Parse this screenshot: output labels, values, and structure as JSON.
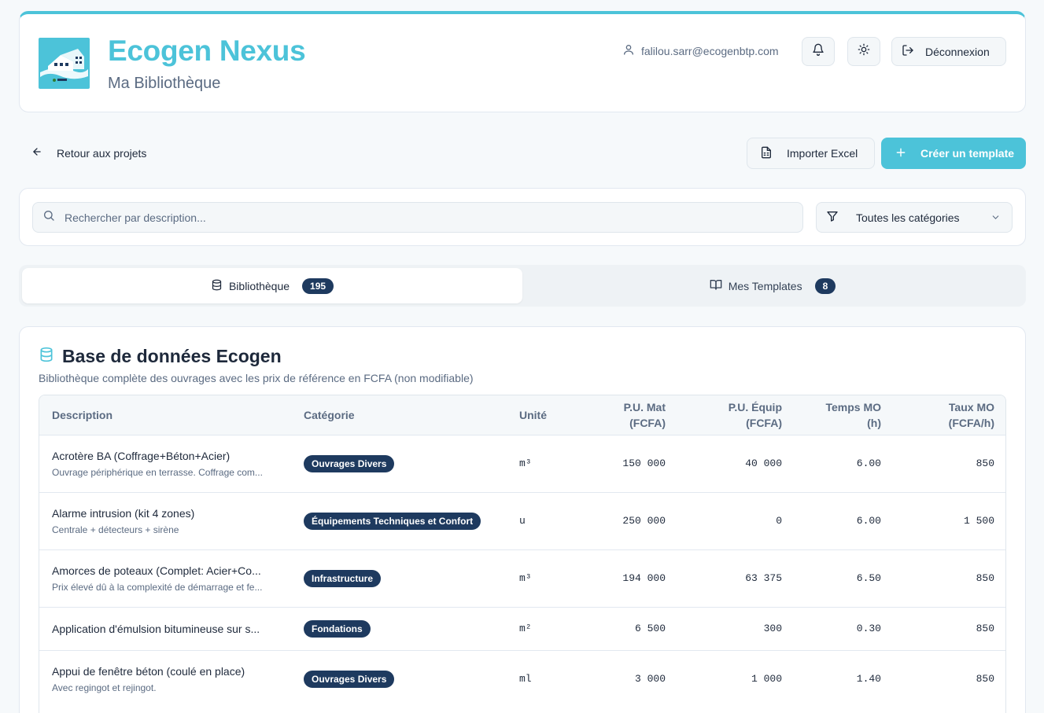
{
  "header": {
    "title": "Ecogen Nexus",
    "subtitle": "Ma Bibliothèque",
    "user_email": "falilou.sarr@ecogenbtp.com",
    "logout_label": "Déconnexion"
  },
  "toolbar": {
    "back_label": "Retour aux projets",
    "import_label": "Importer Excel",
    "create_label": "Créer un template"
  },
  "filters": {
    "search_placeholder": "Rechercher par description...",
    "category_selected": "Toutes les catégories"
  },
  "tabs": [
    {
      "label": "Bibliothèque",
      "count": "195",
      "active": true
    },
    {
      "label": "Mes Templates",
      "count": "8",
      "active": false
    }
  ],
  "library": {
    "title": "Base de données Ecogen",
    "description": "Bibliothèque complète des ouvrages avec les prix de référence en FCFA (non modifiable)",
    "columns": {
      "description": "Description",
      "category": "Catégorie",
      "unit": "Unité",
      "pu_mat_1": "P.U. Mat",
      "pu_mat_2": "(FCFA)",
      "pu_equip_1": "P.U. Équip",
      "pu_equip_2": "(FCFA)",
      "temps_1": "Temps MO",
      "temps_2": "(h)",
      "taux_1": "Taux MO",
      "taux_2": "(FCFA/h)"
    },
    "rows": [
      {
        "title": "Acrotère BA (Coffrage+Béton+Acier)",
        "subtitle": "Ouvrage périphérique en terrasse. Coffrage com...",
        "category": "Ouvrages Divers",
        "unit": "m³",
        "pu_mat": "150 000",
        "pu_equip": "40 000",
        "temps": "6.00",
        "taux": "850"
      },
      {
        "title": "Alarme intrusion (kit 4 zones)",
        "subtitle": "Centrale + détecteurs + sirène",
        "category": "Équipements Techniques et Confort",
        "unit": "u",
        "pu_mat": "250 000",
        "pu_equip": "0",
        "temps": "6.00",
        "taux": "1 500"
      },
      {
        "title": "Amorces de poteaux (Complet: Acier+Co...",
        "subtitle": "Prix élevé dû à la complexité de démarrage et fe...",
        "category": "Infrastructure",
        "unit": "m³",
        "pu_mat": "194 000",
        "pu_equip": "63 375",
        "temps": "6.50",
        "taux": "850"
      },
      {
        "title": "Application d'émulsion bitumineuse sur s...",
        "subtitle": "",
        "category": "Fondations",
        "unit": "m²",
        "pu_mat": "6 500",
        "pu_equip": "300",
        "temps": "0.30",
        "taux": "850"
      },
      {
        "title": "Appui de fenêtre béton (coulé en place)",
        "subtitle": "Avec regingot et rejingot.",
        "category": "Ouvrages Divers",
        "unit": "ml",
        "pu_mat": "3 000",
        "pu_equip": "1 000",
        "temps": "1.40",
        "taux": "850"
      }
    ]
  },
  "colors": {
    "accent": "#4cc3d9",
    "badge": "#1e3a5f",
    "muted_text": "#5b6b82"
  }
}
